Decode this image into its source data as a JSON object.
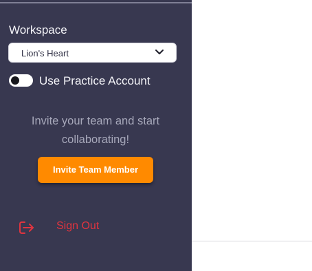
{
  "sidebar": {
    "workspace_label": "Workspace",
    "workspace_select": {
      "value": "Lion's Heart"
    },
    "toggle": {
      "label": "Use Practice Account",
      "checked": false
    },
    "invite": {
      "text": "Invite your team and start collaborating!",
      "button_label": "Invite Team Member"
    },
    "signout": {
      "label": "Sign Out",
      "icon": "logout-icon"
    }
  },
  "colors": {
    "sidebar_bg": "#383850",
    "accent": "#ff8a00",
    "danger": "#e0343f",
    "muted_text": "#a7a8ba"
  }
}
